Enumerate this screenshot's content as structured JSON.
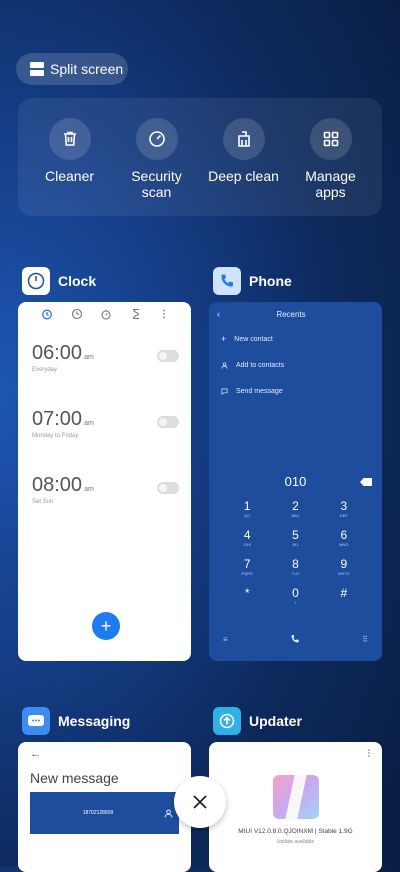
{
  "split_screen": {
    "label": "Split screen"
  },
  "tools": [
    {
      "label": "Cleaner",
      "icon": "trash-icon"
    },
    {
      "label": "Security scan",
      "icon": "speedometer-icon"
    },
    {
      "label": "Deep clean",
      "icon": "broom-icon"
    },
    {
      "label": "Manage apps",
      "icon": "grid-icon"
    }
  ],
  "apps": {
    "clock": {
      "name": "Clock",
      "alarms": [
        {
          "time": "06:00",
          "ampm": "am",
          "days": "Everyday"
        },
        {
          "time": "07:00",
          "ampm": "am",
          "days": "Monday to Friday"
        },
        {
          "time": "08:00",
          "ampm": "am",
          "days": "Sat Sun"
        }
      ],
      "add": "+"
    },
    "phone": {
      "name": "Phone",
      "title": "Recents",
      "actions": [
        "New contact",
        "Add to contacts",
        "Send message"
      ],
      "dialed": "010",
      "keys": [
        {
          "d": "1",
          "l": "QO"
        },
        {
          "d": "2",
          "l": "ABC"
        },
        {
          "d": "3",
          "l": "DEF"
        },
        {
          "d": "4",
          "l": "GHI"
        },
        {
          "d": "5",
          "l": "JKL"
        },
        {
          "d": "6",
          "l": "MNO"
        },
        {
          "d": "7",
          "l": "PQRS"
        },
        {
          "d": "8",
          "l": "TUV"
        },
        {
          "d": "9",
          "l": "WXYZ"
        },
        {
          "d": "*",
          "l": ""
        },
        {
          "d": "0",
          "l": "+"
        },
        {
          "d": "#",
          "l": ""
        }
      ]
    },
    "messaging": {
      "name": "Messaging",
      "title": "New message",
      "recipient": "18702128809"
    },
    "updater": {
      "name": "Updater",
      "version": "MIUI V12.0.8.0.QJOINXM | Stable 1.9G",
      "status": "Update available"
    }
  },
  "colors": {
    "accent": "#1e7bf0",
    "phone_bg": "#1f4d9e"
  }
}
